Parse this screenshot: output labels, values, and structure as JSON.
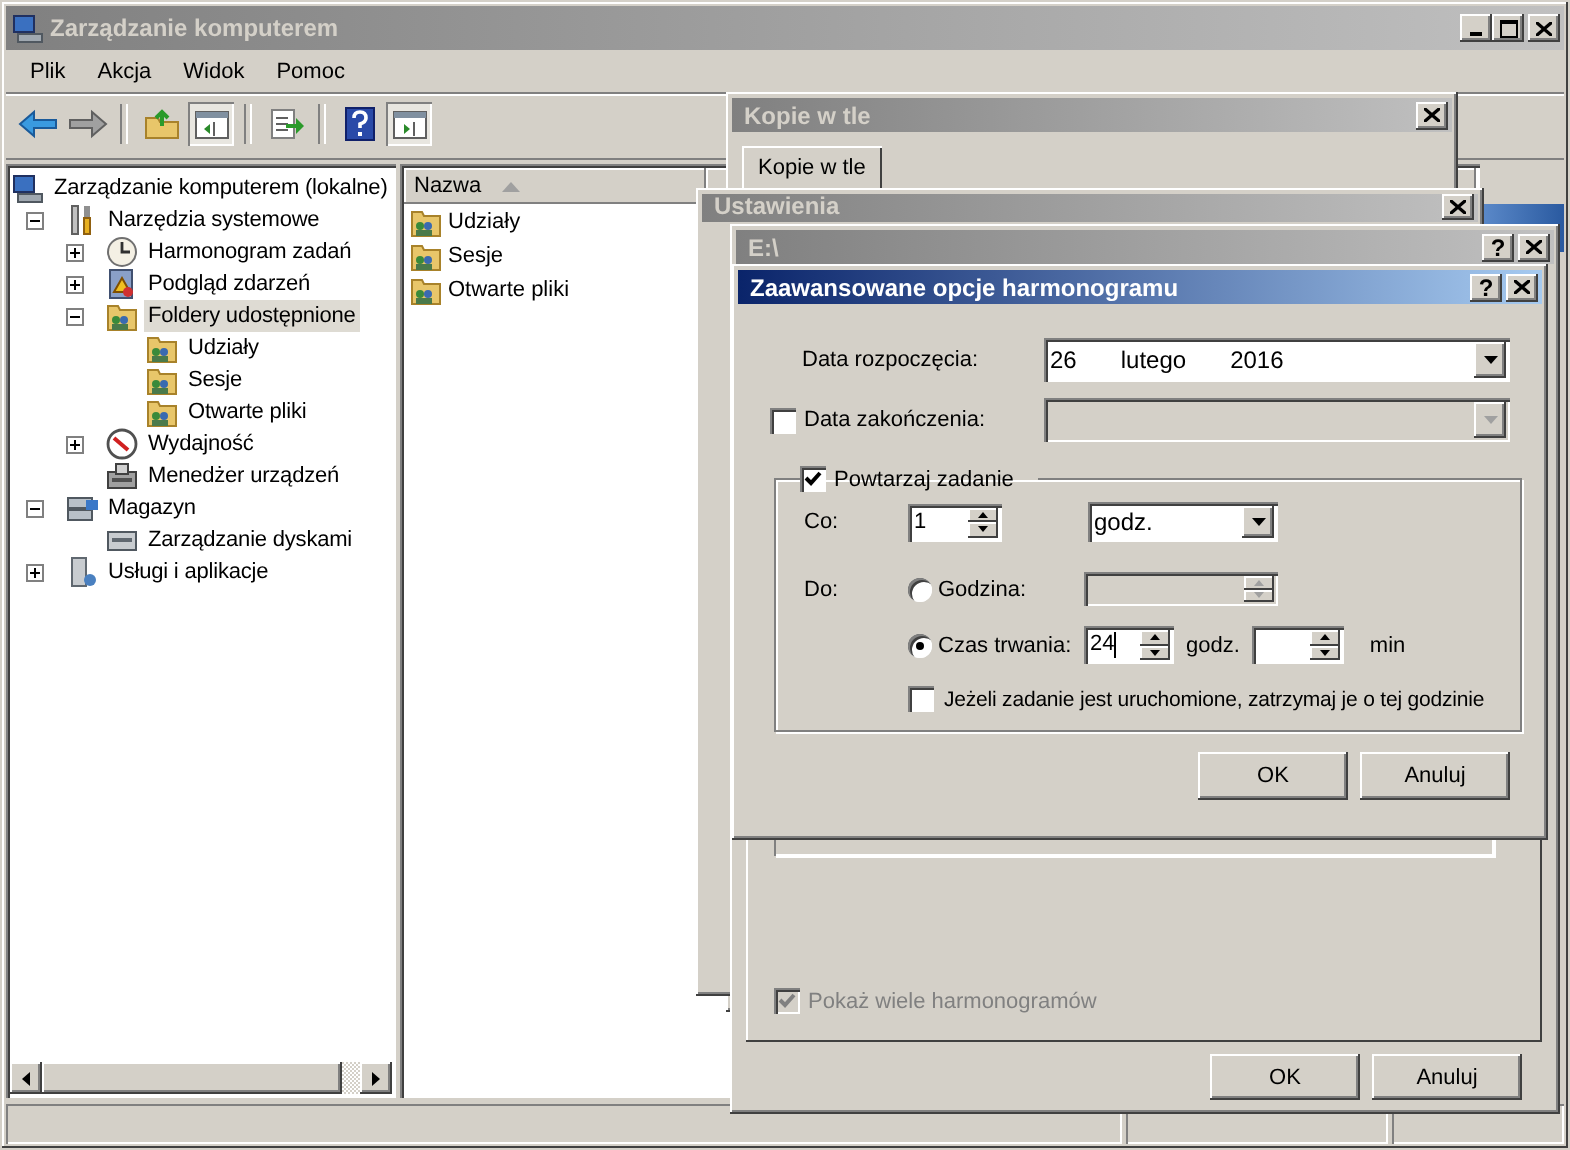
{
  "window": {
    "title": "Zarządzanie komputerem"
  },
  "menu": [
    "Plik",
    "Akcja",
    "Widok",
    "Pomoc"
  ],
  "tree": {
    "items": [
      {
        "label": "Zarządzanie komputerem (lokalne)",
        "selected": false,
        "children": [
          {
            "label": "Narzędzia systemowe",
            "expanded": true,
            "selected": false,
            "children": [
              {
                "label": "Harmonogram zadań",
                "expanded": false,
                "selected": false
              },
              {
                "label": "Podgląd zdarzeń",
                "expanded": false,
                "selected": false
              },
              {
                "label": "Foldery udostępnione",
                "expanded": true,
                "selected": true,
                "children": [
                  {
                    "label": "Udziały",
                    "selected": false
                  },
                  {
                    "label": "Sesje",
                    "selected": false
                  },
                  {
                    "label": "Otwarte pliki",
                    "selected": false
                  }
                ]
              },
              {
                "label": "Wydajność",
                "expanded": false,
                "selected": false
              },
              {
                "label": "Menedżer urządzeń",
                "selected": false
              }
            ]
          },
          {
            "label": "Magazyn",
            "expanded": true,
            "selected": false,
            "children": [
              {
                "label": "Zarządzanie dyskami",
                "selected": false
              }
            ]
          },
          {
            "label": "Usługi i aplikacje",
            "expanded": false,
            "selected": false
          }
        ]
      }
    ]
  },
  "list": {
    "columns": [
      {
        "label": "Nazwa",
        "sort_ascending": true
      }
    ],
    "rows": [
      "Udziały",
      "Sesje",
      "Otwarte pliki"
    ]
  },
  "shadow_copies_window": {
    "title": "Kopie w tle",
    "tabs": [
      {
        "label": "Kopie w tle",
        "selected": true
      }
    ]
  },
  "settings_window": {
    "title": "Ustawienia"
  },
  "drive_window": {
    "title": "E:\\",
    "help_button": "?",
    "show_multiple_schedules": {
      "label": "Pokaż wiele harmonogramów",
      "checked": true,
      "disabled": true
    },
    "buttons": [
      "OK",
      "Anuluj"
    ]
  },
  "advanced_dialog": {
    "title": "Zaawansowane opcje harmonogramu",
    "help_button": "?",
    "start_date": {
      "label": "Data rozpoczęcia:",
      "day": "26",
      "month": "lutego",
      "year": "2016"
    },
    "end_date": {
      "label": "Data zakończenia:",
      "checked": false
    },
    "repeat": {
      "label": "Powtarzaj zadanie",
      "checked": true,
      "every_label": "Co:",
      "every_value": "1",
      "every_unit": "godz.",
      "until_label": "Do:",
      "options": [
        {
          "label": "Godzina:",
          "selected": false
        },
        {
          "label": "Czas trwania:",
          "selected": true
        }
      ],
      "duration_hours": "24",
      "hours_unit": "godz.",
      "minutes_unit": "min",
      "stop_task": {
        "label": "Jeżeli zadanie jest uruchomione, zatrzymaj je o tej godzinie",
        "checked": false
      }
    },
    "buttons": [
      "OK",
      "Anuluj"
    ]
  }
}
